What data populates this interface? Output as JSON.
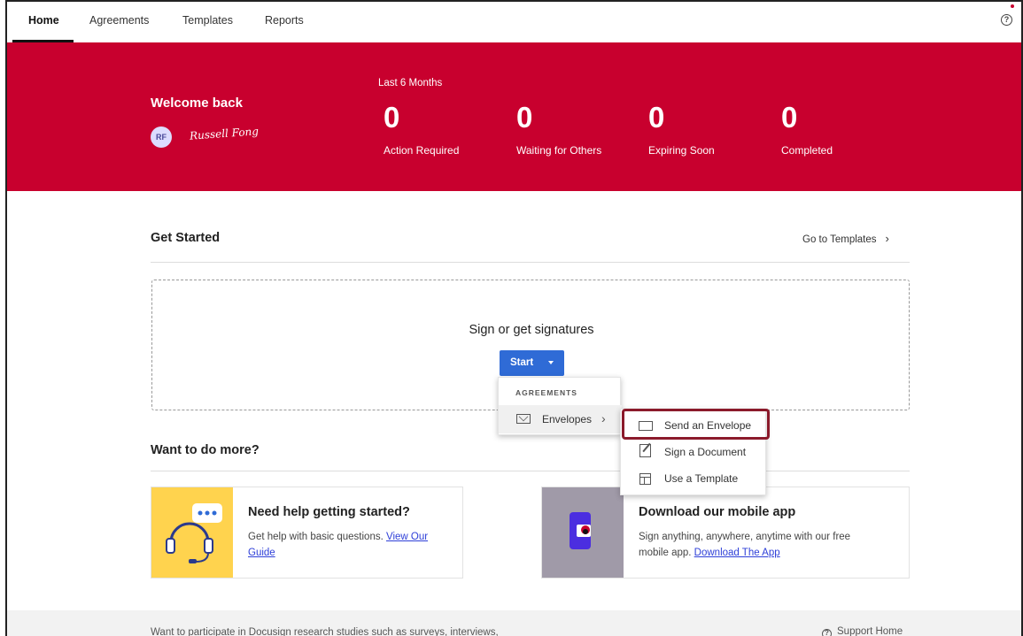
{
  "nav": {
    "tabs": [
      {
        "label": "Home",
        "active": true
      },
      {
        "label": "Agreements"
      },
      {
        "label": "Templates"
      },
      {
        "label": "Reports"
      }
    ],
    "help_icon": "question-circle-icon"
  },
  "banner": {
    "welcome": "Welcome back",
    "avatar_initials": "RF",
    "signature": "Russell Fong",
    "period": "Last 6 Months",
    "stats": [
      {
        "value": "0",
        "label": "Action Required"
      },
      {
        "value": "0",
        "label": "Waiting for Others"
      },
      {
        "value": "0",
        "label": "Expiring Soon"
      },
      {
        "value": "0",
        "label": "Completed"
      }
    ],
    "color": "#c8002e"
  },
  "get_started": {
    "title": "Get Started",
    "goto_templates": "Go to Templates",
    "drop_label": "Sign or get signatures",
    "start_button": "Start"
  },
  "start_menu": {
    "header": "AGREEMENTS",
    "envelopes": "Envelopes",
    "submenu": [
      {
        "label": "Send an Envelope",
        "icon": "envelope-icon"
      },
      {
        "label": "Sign a Document",
        "icon": "edit-document-icon"
      },
      {
        "label": "Use a Template",
        "icon": "template-icon"
      }
    ]
  },
  "more": {
    "title": "Want to do more?",
    "cards": [
      {
        "title": "Need help getting started?",
        "text": "Get help with basic questions.",
        "link": "View Our Guide",
        "icon": "headset-icon"
      },
      {
        "title": "Download our mobile app",
        "text": "Sign anything, anywhere, anytime with our free mobile app.",
        "link": "Download The App",
        "icon": "phone-icon"
      }
    ]
  },
  "footer": {
    "text": "Want to participate in Docusign research studies such as surveys, interviews,",
    "support": "Support Home"
  }
}
